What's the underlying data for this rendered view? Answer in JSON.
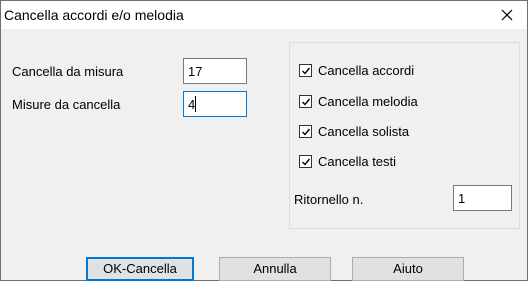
{
  "window": {
    "title": "Cancella accordi e/o melodia",
    "close_symbol": "×"
  },
  "left": {
    "from_measure_label": "Cancella da misura",
    "from_measure_value": "17",
    "count_label": "Misure da cancella",
    "count_value": "4"
  },
  "group": {
    "options": [
      {
        "label": "Cancella accordi",
        "checked": true
      },
      {
        "label": "Cancella melodia",
        "checked": true
      },
      {
        "label": "Cancella solista",
        "checked": true
      },
      {
        "label": "Cancella testi",
        "checked": true
      }
    ],
    "chorus_label": "Ritornello n.",
    "chorus_value": "1"
  },
  "buttons": {
    "ok_label": "OK-Cancella",
    "cancel_label": "Annulla",
    "help_label": "Aiuto"
  },
  "colors": {
    "focus_accent": "#0078d7",
    "dialog_bg": "#f0f0f0"
  },
  "icons": {
    "close": "close-icon",
    "check": "checkmark-icon"
  }
}
